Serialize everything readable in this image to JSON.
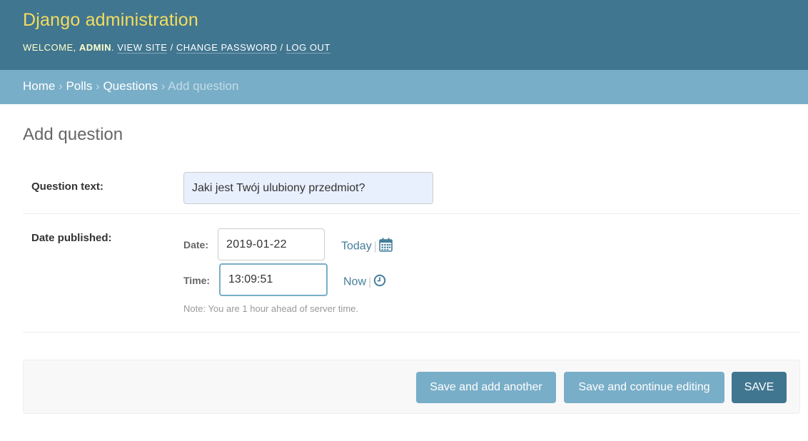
{
  "header": {
    "site_title": "Django administration",
    "welcome_prefix": "Welcome, ",
    "username": "admin",
    "welcome_suffix": ". ",
    "view_site": "View site",
    "separator": " / ",
    "change_password": "Change password",
    "log_out": "Log out"
  },
  "breadcrumbs": {
    "home": "Home",
    "app": "Polls",
    "model": "Questions",
    "current": "Add question",
    "sep": " › "
  },
  "page": {
    "title": "Add question"
  },
  "form": {
    "question_text": {
      "label": "Question text:",
      "value": "Jaki jest Twój ulubiony przedmiot?"
    },
    "date_published": {
      "label": "Date published:",
      "date_label": "Date:",
      "date_value": "2019-01-22",
      "today_link": "Today",
      "time_label": "Time:",
      "time_value": "13:09:51",
      "now_link": "Now",
      "shortcut_sep": "|",
      "note": "Note: You are 1 hour ahead of server time."
    }
  },
  "submit_row": {
    "save_add_another": "Save and add another",
    "save_continue": "Save and continue editing",
    "save": "Save"
  },
  "icons": {
    "calendar": "calendar-icon",
    "clock": "clock-icon"
  },
  "colors": {
    "header_bg": "#417690",
    "breadcrumbs_bg": "#79aec8",
    "title_yellow": "#f5dd5d",
    "link": "#447e9b",
    "button": "#79aec8",
    "button_default": "#417690"
  }
}
